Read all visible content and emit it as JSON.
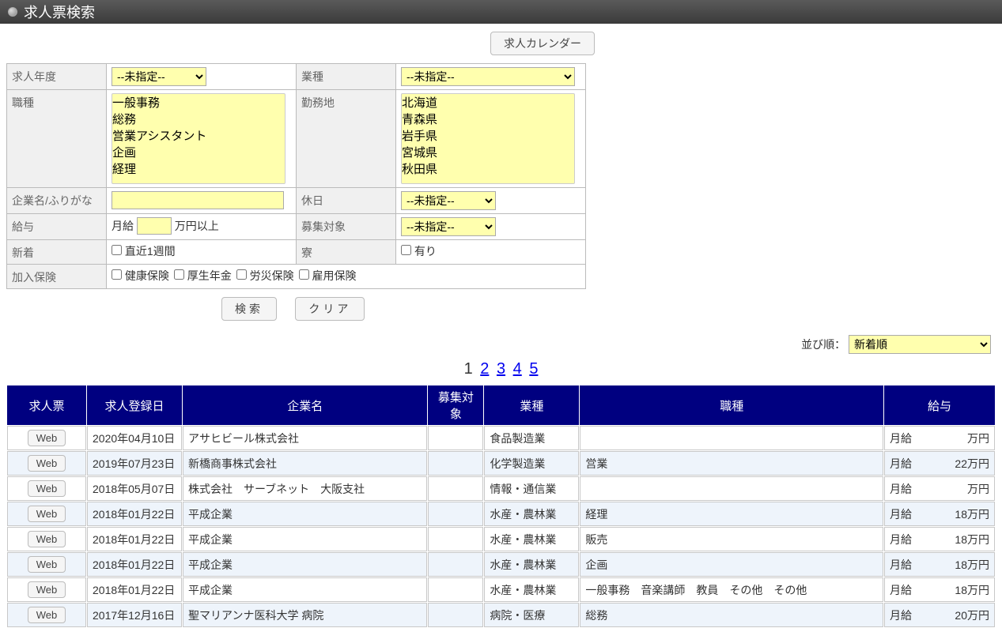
{
  "header": {
    "title": "求人票検索"
  },
  "top_button": "求人カレンダー",
  "form": {
    "labels": {
      "year": "求人年度",
      "industry": "業種",
      "job_type": "職種",
      "location": "勤務地",
      "company": "企業名/ふりがな",
      "holiday": "休日",
      "salary": "給与",
      "target": "募集対象",
      "new": "新着",
      "dorm": "寮",
      "insurance": "加入保険"
    },
    "unspecified": "--未指定--",
    "job_type_options": [
      "一般事務",
      "総務",
      "営業アシスタント",
      "企画",
      "経理"
    ],
    "location_options": [
      "北海道",
      "青森県",
      "岩手県",
      "宮城県",
      "秋田県"
    ],
    "salary_prefix": "月給",
    "salary_suffix": "万円以上",
    "new_checkbox": "直近1週間",
    "dorm_checkbox": "有り",
    "insurance_options": [
      "健康保険",
      "厚生年金",
      "労災保険",
      "雇用保険"
    ]
  },
  "buttons": {
    "search": "検索",
    "clear": "クリア"
  },
  "sort": {
    "label": "並び順：",
    "selected": "新着順"
  },
  "pagination": {
    "current": 1,
    "pages": [
      1,
      2,
      3,
      4,
      5
    ]
  },
  "results": {
    "columns": [
      "求人票",
      "求人登録日",
      "企業名",
      "募集対象",
      "業種",
      "職種",
      "給与"
    ],
    "web_button": "Web",
    "rows": [
      {
        "date": "2020年04月10日",
        "company": "アサヒビール株式会社",
        "target": "",
        "industry": "食品製造業",
        "job": "",
        "salary_type": "月給",
        "salary": "万円"
      },
      {
        "date": "2019年07月23日",
        "company": "新橋商事株式会社",
        "target": "",
        "industry": "化学製造業",
        "job": "営業",
        "salary_type": "月給",
        "salary": "22万円"
      },
      {
        "date": "2018年05月07日",
        "company": "株式会社　サーブネット　大阪支社",
        "target": "",
        "industry": "情報・通信業",
        "job": "",
        "salary_type": "月給",
        "salary": "万円"
      },
      {
        "date": "2018年01月22日",
        "company": "平成企業",
        "target": "",
        "industry": "水産・農林業",
        "job": "経理",
        "salary_type": "月給",
        "salary": "18万円"
      },
      {
        "date": "2018年01月22日",
        "company": "平成企業",
        "target": "",
        "industry": "水産・農林業",
        "job": "販売",
        "salary_type": "月給",
        "salary": "18万円"
      },
      {
        "date": "2018年01月22日",
        "company": "平成企業",
        "target": "",
        "industry": "水産・農林業",
        "job": "企画",
        "salary_type": "月給",
        "salary": "18万円"
      },
      {
        "date": "2018年01月22日",
        "company": "平成企業",
        "target": "",
        "industry": "水産・農林業",
        "job": "一般事務　音楽講師　教員　その他　その他",
        "salary_type": "月給",
        "salary": "18万円"
      },
      {
        "date": "2017年12月16日",
        "company": "聖マリアンナ医科大学 病院",
        "target": "",
        "industry": "病院・医療",
        "job": "総務",
        "salary_type": "月給",
        "salary": "20万円"
      }
    ]
  }
}
